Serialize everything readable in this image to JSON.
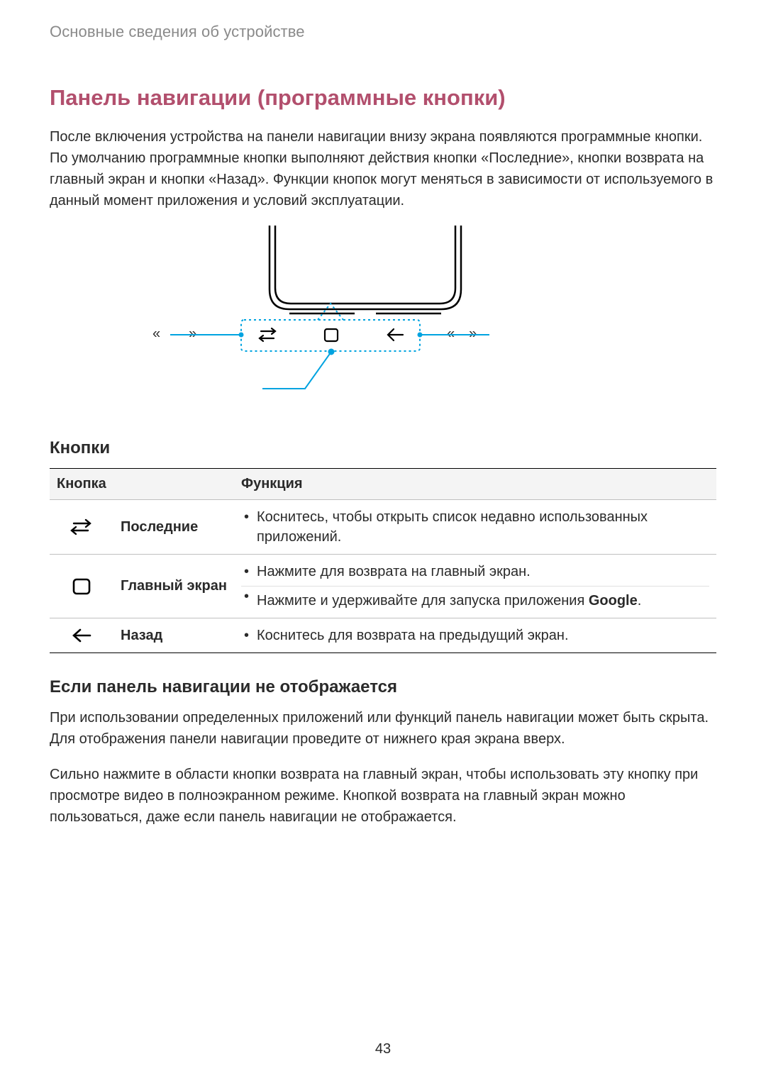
{
  "chapter": "Основные сведения об устройстве",
  "h1": "Панель навигации (программные кнопки)",
  "intro": "После включения устройства на панели навигации внизу экрана появляются программные кнопки. По умолчанию программные кнопки выполняют действия кнопки «Последние», кнопки возврата на главный экран и кнопки «Назад». Функции кнопок могут меняться в зависимости от используемого в данный момент приложения и условий эксплуатации.",
  "figure": {
    "label_left_q1": "«",
    "label_left_q2": "»",
    "label_right_q1": "«",
    "label_right_q2": "»"
  },
  "h2_buttons": "Кнопки",
  "table": {
    "head": {
      "col1": "Кнопка",
      "col2": "Функция"
    },
    "rows": [
      {
        "icon": "recents",
        "name": "Последние",
        "funcs": [
          "Коснитесь, чтобы открыть список недавно использованных приложений."
        ]
      },
      {
        "icon": "home",
        "name": "Главный экран",
        "funcs": [
          "Нажмите для возврата на главный экран.",
          "Нажмите и удерживайте для запуска приложения <b>Google</b>."
        ]
      },
      {
        "icon": "back",
        "name": "Назад",
        "funcs": [
          "Коснитесь для возврата на предыдущий экран."
        ]
      }
    ]
  },
  "h2_hidden": "Если панель навигации не отображается",
  "para_hidden_1": "При использовании определенных приложений или функций панель навигации может быть скрыта. Для отображения панели навигации проведите от нижнего края экрана вверх.",
  "para_hidden_2": "Сильно нажмите в области кнопки возврата на главный экран, чтобы использовать эту кнопку при просмотре видео в полноэкранном режиме. Кнопкой возврата на главный экран можно пользоваться, даже если панель навигации не отображается.",
  "page_number": "43"
}
